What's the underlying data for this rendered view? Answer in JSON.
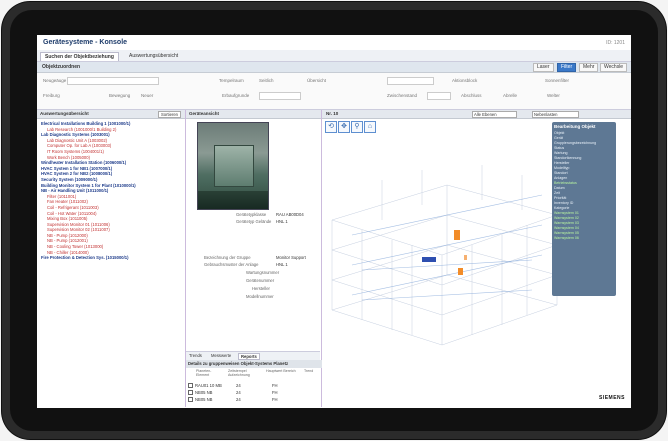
{
  "app": {
    "title": "Gerätesysteme - Konsole",
    "user": "ID: 1201"
  },
  "tabs": [
    {
      "label": "Suchen der Objektbeziehung"
    },
    {
      "label": "Auswertungsübersicht"
    }
  ],
  "section": {
    "label": "Objektzuordnen"
  },
  "toolbar": {
    "buttons": [
      "Laser",
      "Filter",
      "Mehr",
      "Wechsle"
    ]
  },
  "form": {
    "row1": [
      "Neugeäuge",
      "Tempelraum",
      "Seitlich",
      "Übersicht",
      "Aktionsblock",
      "Sonnenfilter"
    ],
    "row2": [
      "Freiburg",
      "Bewegung",
      "Neuer",
      "Erbaufgrunde",
      "Zwischenstand",
      "Abschluss",
      "Abrelle",
      "Welter"
    ]
  },
  "left_panel": {
    "header": "Auswertungsübersicht",
    "filter_label": "Sortieren",
    "items": [
      {
        "text": "Electrical Installations Building 1 (1001000/1)",
        "color": "blue"
      },
      {
        "text": "Lab Research (1001000/1 Building 2)",
        "color": "red"
      },
      {
        "text": "Lab Diagnostic Systems (1003001)",
        "color": "blue"
      },
      {
        "text": "Lab Diagnostic Unit A (1003002)",
        "color": "red"
      },
      {
        "text": "Computer Op. for Lab A (1003003)",
        "color": "red"
      },
      {
        "text": "IT Room Systems (1004001/1)",
        "color": "red"
      },
      {
        "text": "Work Bench (1005000)",
        "color": "red"
      },
      {
        "text": "Windheater Installation Station (1006000/1)",
        "color": "blue"
      },
      {
        "text": "HVAC System 1 for NB1 (1007000/1)",
        "color": "blue"
      },
      {
        "text": "HVAC System 2 for NB2 (1008000/1)",
        "color": "blue"
      },
      {
        "text": "Security System (1009000/1)",
        "color": "blue"
      },
      {
        "text": "Building Monitor System 1 for Plant (1010000/1)",
        "color": "blue"
      },
      {
        "text": "NB - Air Handling Unit (1011000/1)",
        "color": "blue"
      },
      {
        "text": "Filter (1011001)",
        "color": "red"
      },
      {
        "text": "Fan Heater (1011002)",
        "color": "red"
      },
      {
        "text": "Coil - Refrigerant (1011003)",
        "color": "red"
      },
      {
        "text": "Coil - Hot Water (1011004)",
        "color": "red"
      },
      {
        "text": "Mixing Box (1011005)",
        "color": "red"
      },
      {
        "text": "Supervision Monitor 01 (1011006)",
        "color": "red"
      },
      {
        "text": "Supervision Monitor 02 (1011007)",
        "color": "red"
      },
      {
        "text": "NB - Pump (1012000)",
        "color": "red"
      },
      {
        "text": "NB - Pump (1012001)",
        "color": "red"
      },
      {
        "text": "NB - Cooling Tower (1013000)",
        "color": "red"
      },
      {
        "text": "NB - Chiller (1014000)",
        "color": "red"
      },
      {
        "text": "Fire Protection & Detection Sys. (1015000/1)",
        "color": "blue"
      }
    ]
  },
  "middle_panel": {
    "header": "Geräteansicht",
    "props_top": [
      {
        "k": "Gerätetypklasse",
        "v": "RAU AB00D04"
      },
      {
        "k": "Gerätetyp Gelände",
        "v": "HNL 1"
      }
    ],
    "props_bottom": [
      {
        "k": "Bezeichnung der Gruppe",
        "v": "Monitor Support"
      },
      {
        "k": "Gebrauchsmuster der Anlage",
        "v": "HNL 1"
      },
      {
        "k": "Wartungsnummer",
        "v": ""
      },
      {
        "k": "Gerätenummer",
        "v": ""
      },
      {
        "k": "Hersteller",
        "v": ""
      },
      {
        "k": "Modellnummer",
        "v": ""
      }
    ],
    "subtabs": [
      "Trends",
      "Messwerte",
      "Reports"
    ],
    "table_header": "Details zu gruppenweisen Objekt-Systems Planetz",
    "columns": [
      "Planeten-Element",
      "Zeitstempel Aufzeichnung",
      "Hauptwert Bereich",
      "Trend"
    ],
    "rows": [
      {
        "id": "RAU01 10 MB",
        "a": "24",
        "b": "FH"
      },
      {
        "id": "NB05 NB",
        "a": "24",
        "b": "FH"
      },
      {
        "id": "NB05 NB",
        "a": "24",
        "b": "FH"
      }
    ]
  },
  "viewer": {
    "label": "Nr. 10",
    "dropdown1": "Alle Ebenen",
    "dropdown2": "Nebenlasten",
    "icons": [
      "rotate-icon",
      "move-icon",
      "tree-icon",
      "home-icon"
    ],
    "info": {
      "title": "Bearbeitung Objekt",
      "rows": [
        {
          "t": "Objekt",
          "c": "w"
        },
        {
          "t": "Gerät",
          "c": "w"
        },
        {
          "t": "Gruppierungsbezeichnung",
          "c": "w"
        },
        {
          "t": "Status",
          "c": "w"
        },
        {
          "t": "Wartung",
          "c": "w"
        },
        {
          "t": "Standortkennung",
          "c": "w"
        },
        {
          "t": "Hersteller",
          "c": "w"
        },
        {
          "t": "Modelltyp",
          "c": "w"
        },
        {
          "t": "Standort",
          "c": "w"
        },
        {
          "t": "Anlagen",
          "c": "w"
        },
        {
          "t": "Betriebsstatus",
          "c": "g"
        },
        {
          "t": "Datum",
          "c": "w"
        },
        {
          "t": "Zeit",
          "c": "w"
        },
        {
          "t": "Priorität",
          "c": "w"
        },
        {
          "t": "Inventory ID",
          "c": "w"
        },
        {
          "t": "Kategorie",
          "c": "w"
        },
        {
          "t": "Warnsystem 01",
          "c": "g"
        },
        {
          "t": "Warnsystem 02",
          "c": "g"
        },
        {
          "t": "Warnsystem 03",
          "c": "g"
        },
        {
          "t": "Warnsystem 04",
          "c": "g"
        },
        {
          "t": "Warnsystem 05",
          "c": "g"
        },
        {
          "t": "Warnsystem 06",
          "c": "g"
        }
      ]
    },
    "logo": "SIEMENS"
  },
  "colors": {
    "accent": "#3a78c8",
    "tree_blue": "#1d3b8a",
    "tree_red": "#c23030",
    "highlight": "#f28c28",
    "selection": "#2e4fb0"
  }
}
